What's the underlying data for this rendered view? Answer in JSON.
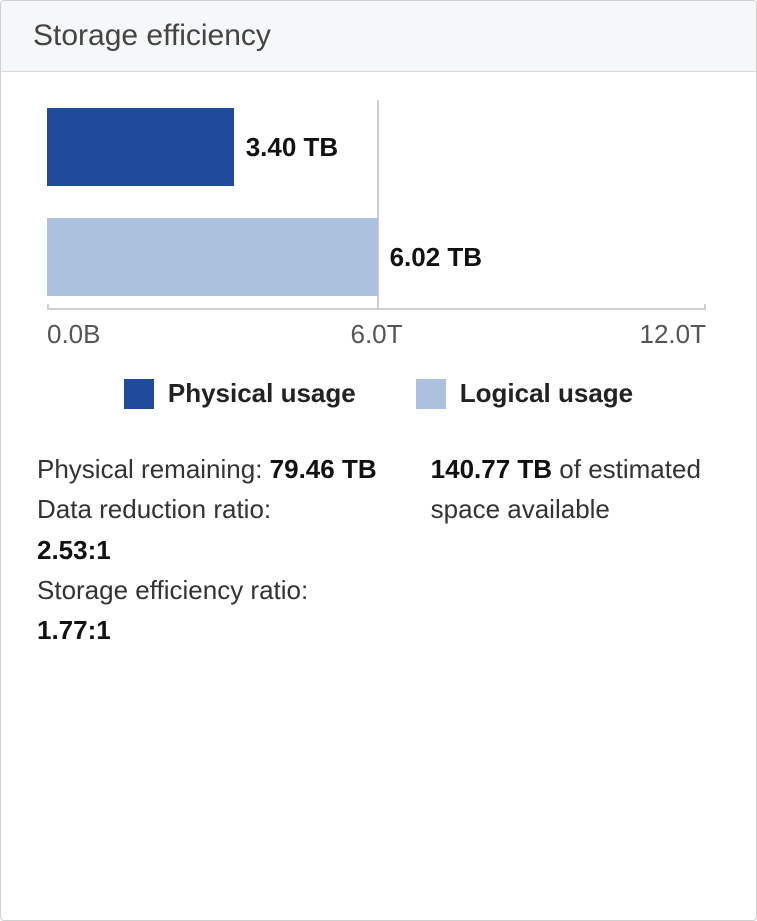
{
  "panel": {
    "title": "Storage efficiency"
  },
  "chart_data": {
    "type": "bar",
    "orientation": "horizontal",
    "xlim": [
      0,
      12
    ],
    "x_unit": "T",
    "series": [
      {
        "name": "Physical usage",
        "value": 3.4,
        "label": "3.40 TB",
        "color": "#1e4b9b"
      },
      {
        "name": "Logical usage",
        "value": 6.02,
        "label": "6.02 TB",
        "color": "#acc1dd"
      }
    ],
    "ticks": [
      {
        "pos": 0,
        "label": "0.0B"
      },
      {
        "pos": 6,
        "label": "6.0T"
      },
      {
        "pos": 12,
        "label": "12.0T"
      }
    ]
  },
  "legend": {
    "physical": "Physical usage",
    "logical": "Logical usage"
  },
  "stats": {
    "physical_remaining_label": "Physical remaining: ",
    "physical_remaining_value": "79.46 TB",
    "data_reduction_label": "Data reduction ratio:",
    "data_reduction_value": "2.53:1",
    "storage_eff_label": "Storage efficiency ratio:",
    "storage_eff_value": "1.77:1",
    "estimated_value": "140.77 TB",
    "estimated_suffix": " of estimated space available"
  }
}
